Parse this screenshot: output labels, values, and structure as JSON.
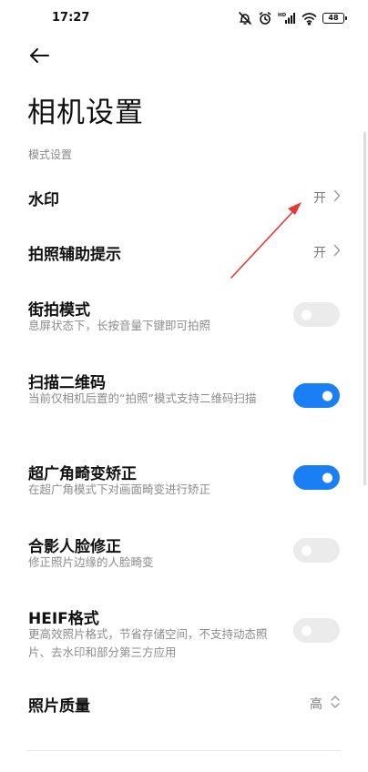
{
  "status_bar": {
    "time": "17:27",
    "battery": "48",
    "icons": [
      "alarm-off-icon",
      "alarm-clock-icon",
      "signal-hd-icon",
      "wifi-icon",
      "battery-icon"
    ]
  },
  "header": {
    "back_icon": "back-arrow-icon",
    "title": "相机设置"
  },
  "section": {
    "label": "模式设置"
  },
  "settings": [
    {
      "title": "水印",
      "value": "开",
      "control": "chevron-right-icon"
    },
    {
      "title": "拍照辅助提示",
      "value": "开",
      "control": "chevron-right-icon"
    },
    {
      "title": "街拍模式",
      "subtitle": "息屏状态下，长按音量下键即可拍照",
      "toggle": false
    },
    {
      "title": "扫描二维码",
      "subtitle": "当前仅相机后置的“拍照”模式支持二维码扫描",
      "toggle": true
    },
    {
      "title": "超广角畸变矫正",
      "subtitle": "在超广角模式下对画面畸变进行矫正",
      "toggle": true
    },
    {
      "title": "合影人脸修正",
      "subtitle": "修正照片边缘的人脸畸变",
      "toggle": false
    },
    {
      "title": "HEIF格式",
      "subtitle": "更高效照片格式，节省存储空间，不支持动态照片、去水印和部分第三方应用",
      "toggle": false
    },
    {
      "title": "照片质量",
      "value": "高",
      "control": "chevron-up-down-icon"
    }
  ],
  "colors": {
    "toggle_on": "#1a7ef5",
    "toggle_off": "#ebebeb",
    "annotation_arrow": "#e53935"
  }
}
